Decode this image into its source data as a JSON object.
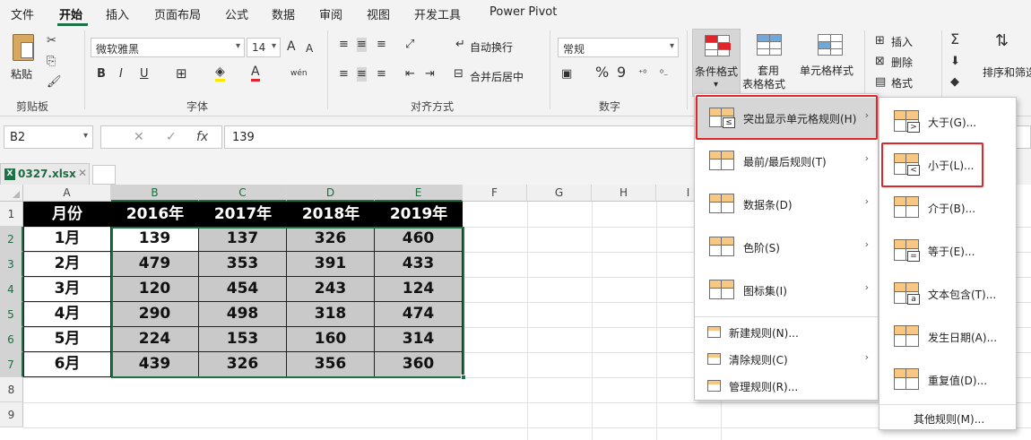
{
  "menubar": [
    "文件",
    "开始",
    "插入",
    "页面布局",
    "公式",
    "数据",
    "审阅",
    "视图",
    "开发工具",
    "Power Pivot"
  ],
  "ribbon": {
    "clipboard": {
      "paste": "粘贴",
      "group": "剪贴板"
    },
    "font": {
      "name": "微软雅黑",
      "size": "14",
      "bold": "B",
      "italic": "I",
      "underline": "U",
      "font_color_glyph": "A",
      "phonetic": "wén",
      "grow": "A",
      "shrink": "A",
      "group": "字体"
    },
    "align": {
      "wrap": "自动换行",
      "merge": "合并后居中",
      "group": "对齐方式"
    },
    "number": {
      "format": "常规",
      "percent": "%",
      "comma": "9",
      "group": "数字"
    },
    "styles": {
      "cond_format": "条件格式",
      "table_format_1": "套用",
      "table_format_2": "表格格式",
      "cell_style": "单元格样式"
    },
    "cells": {
      "insert": "插入",
      "delete": "删除",
      "format": "格式"
    },
    "editing": {
      "sum": "Σ",
      "sort": "排序和筛选"
    }
  },
  "formula_bar": {
    "name_box": "B2",
    "cancel": "✕",
    "enter": "✓",
    "fx": "fx",
    "value": "139"
  },
  "workbook": {
    "tab": "0327.xlsx",
    "close": "✕",
    "icon": "X"
  },
  "grid": {
    "columns": [
      "A",
      "B",
      "C",
      "D",
      "E",
      "F",
      "G",
      "H",
      "I"
    ],
    "rows": [
      "1",
      "2",
      "3",
      "4",
      "5",
      "6",
      "7",
      "8",
      "9"
    ],
    "header": [
      "月份",
      "2016年",
      "2017年",
      "2018年",
      "2019年"
    ],
    "data": [
      [
        "1月",
        "139",
        "137",
        "326",
        "460"
      ],
      [
        "2月",
        "479",
        "353",
        "391",
        "433"
      ],
      [
        "3月",
        "120",
        "454",
        "243",
        "124"
      ],
      [
        "4月",
        "290",
        "498",
        "318",
        "474"
      ],
      [
        "5月",
        "224",
        "153",
        "160",
        "314"
      ],
      [
        "6月",
        "439",
        "326",
        "356",
        "360"
      ]
    ]
  },
  "cond_menu": [
    {
      "label": "突出显示单元格规则(H)",
      "icon": "highlight-cells-icon"
    },
    {
      "label": "最前/最后规则(T)",
      "icon": "top-bottom-icon"
    },
    {
      "label": "数据条(D)",
      "icon": "data-bars-icon"
    },
    {
      "label": "色阶(S)",
      "icon": "color-scales-icon"
    },
    {
      "label": "图标集(I)",
      "icon": "icon-sets-icon"
    }
  ],
  "cond_menu_small": [
    {
      "label": "新建规则(N)...",
      "icon": "new-rule-icon"
    },
    {
      "label": "清除规则(C)",
      "icon": "clear-rules-icon"
    },
    {
      "label": "管理规则(R)...",
      "icon": "manage-rules-icon"
    }
  ],
  "sub_menu": [
    {
      "label": "大于(G)...",
      "tag": ">"
    },
    {
      "label": "小于(L)...",
      "tag": "<"
    },
    {
      "label": "介于(B)...",
      "tag": ""
    },
    {
      "label": "等于(E)...",
      "tag": "="
    },
    {
      "label": "文本包含(T)...",
      "tag": "a"
    },
    {
      "label": "发生日期(A)...",
      "tag": ""
    },
    {
      "label": "重复值(D)...",
      "tag": ""
    }
  ],
  "sub_more": "其他规则(M)...",
  "submenu_tag": "≤",
  "colors": {
    "accent": "#1e7145",
    "highlight_red": "#e0262b",
    "shade": "#c9c9c9"
  }
}
